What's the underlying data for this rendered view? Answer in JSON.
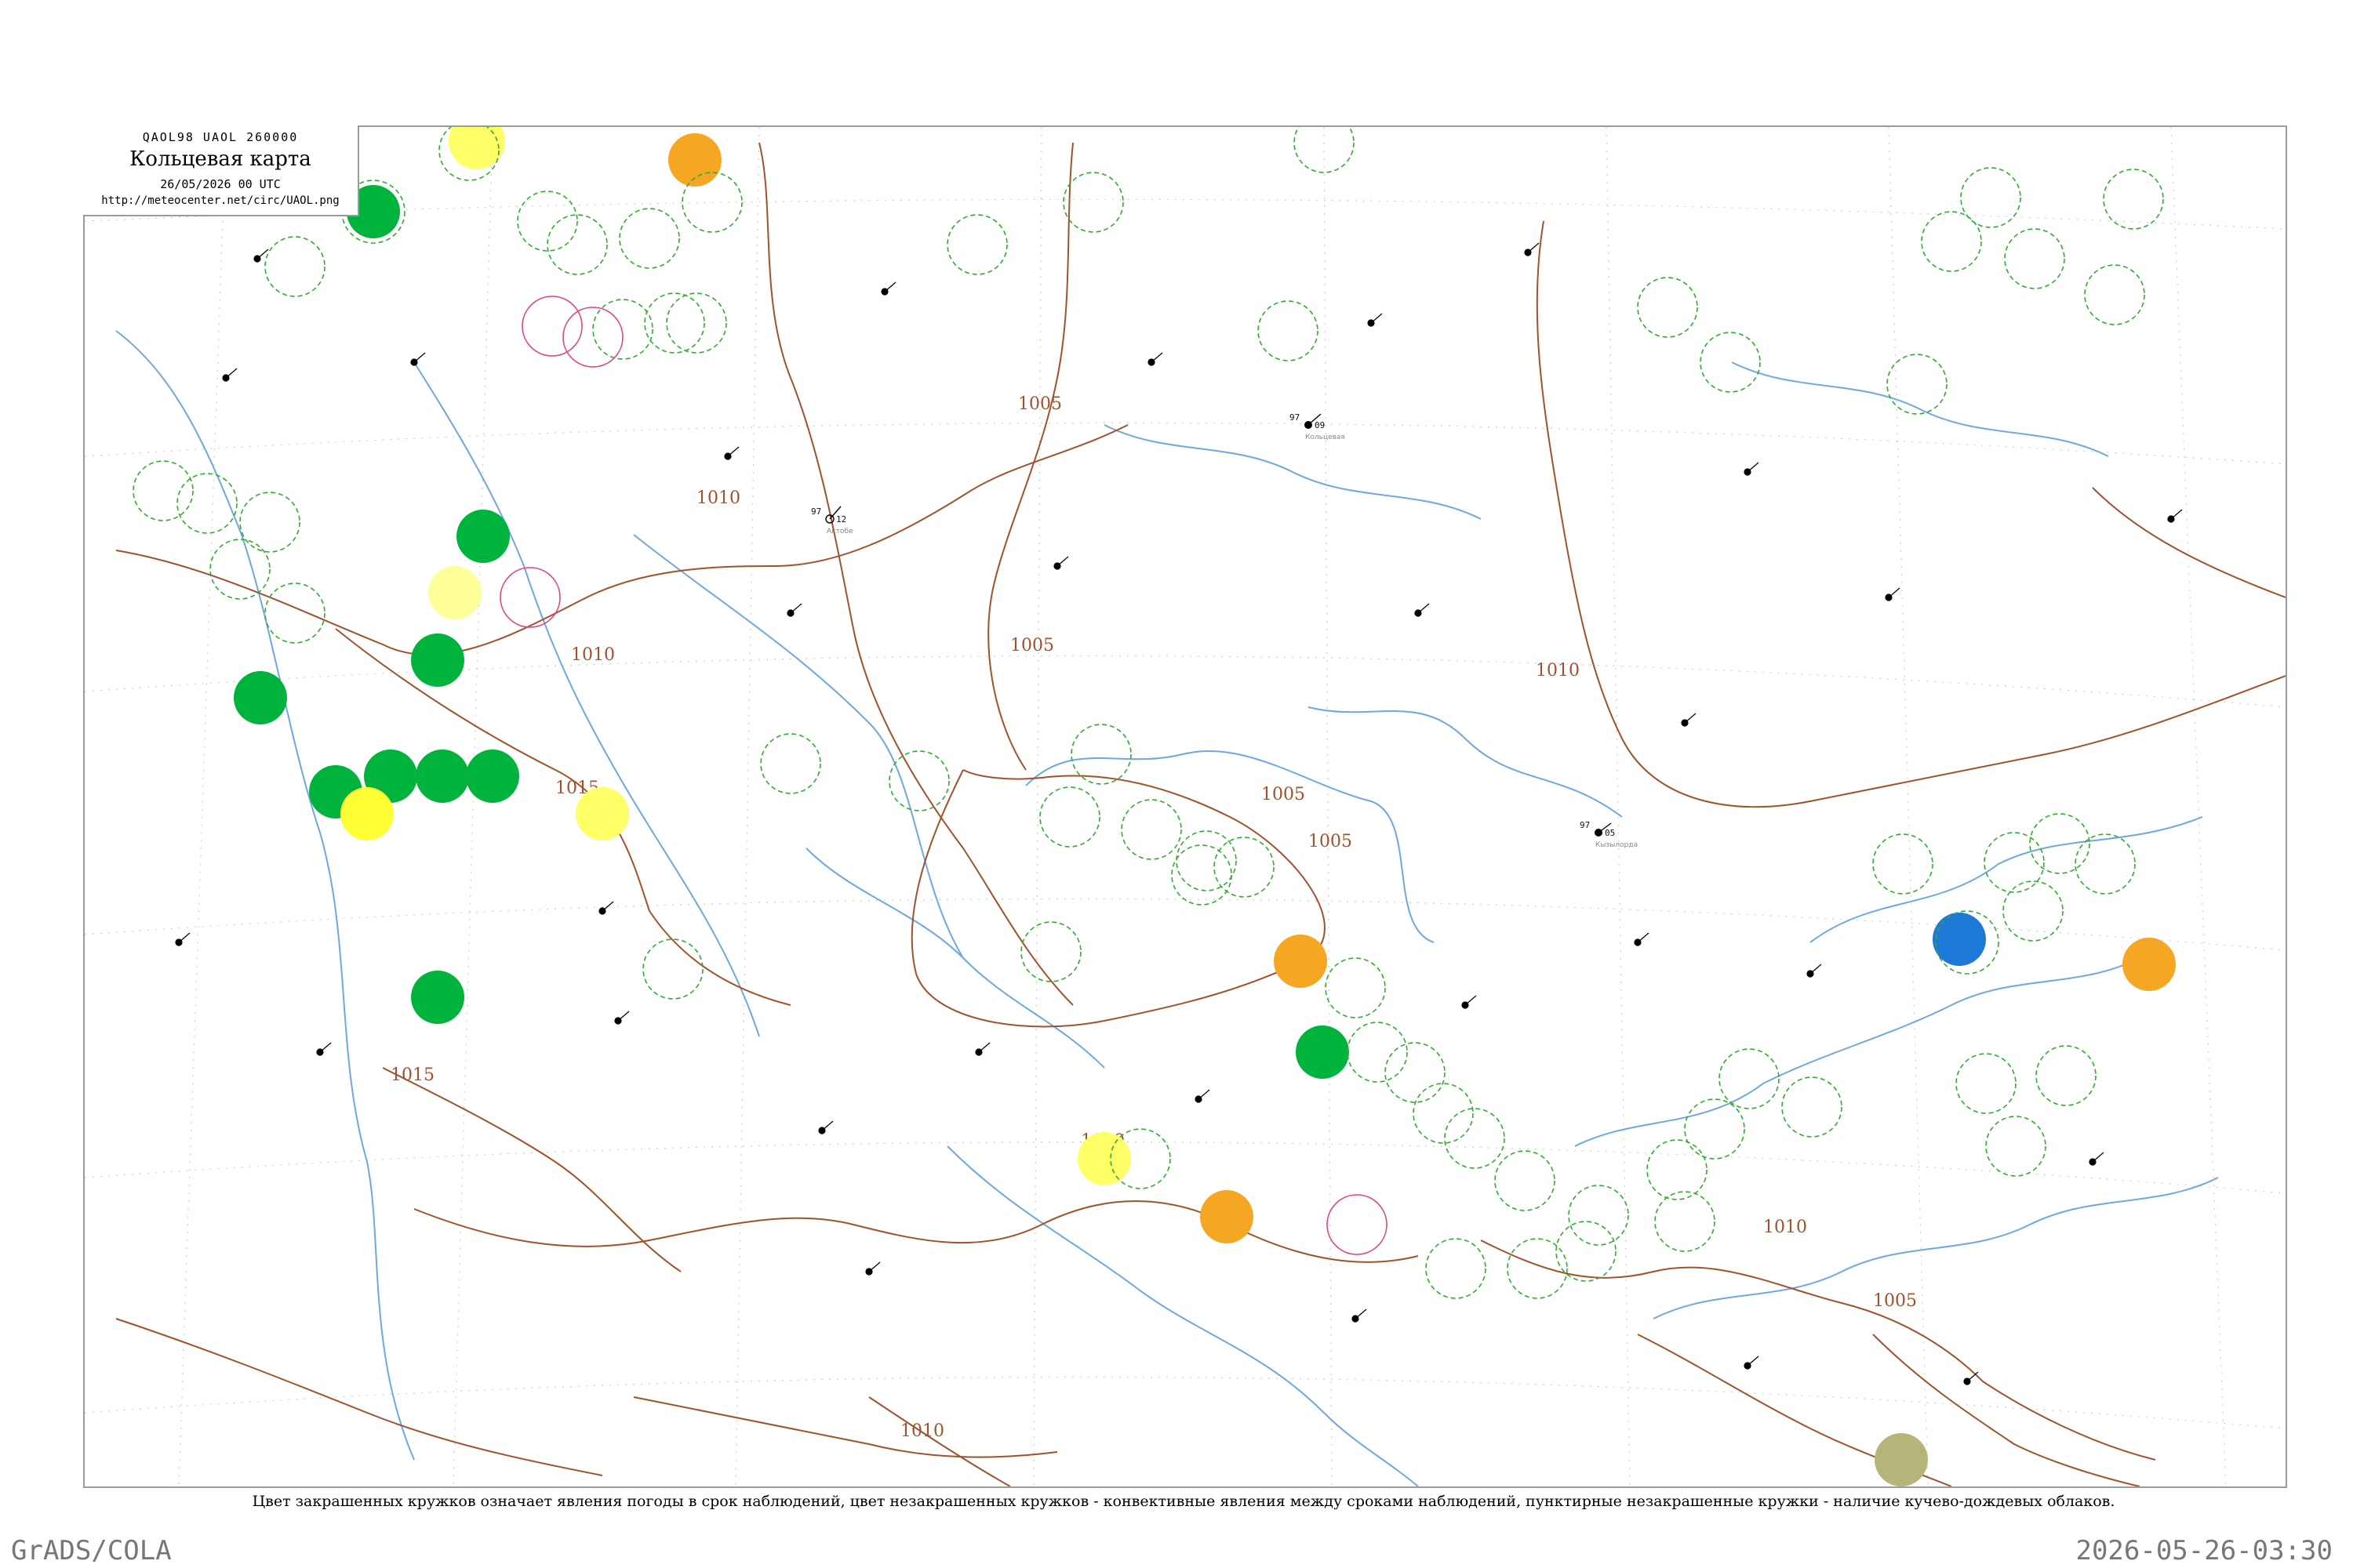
{
  "header": {
    "code": "QAOL98  UAOL  260000",
    "title": "Кольцевая карта",
    "datetime": "26/05/2026 00 UTC",
    "url": "http://meteocenter.net/circ/UAOL.png"
  },
  "caption": "Цвет закрашенных кружков означает явления погоды в срок наблюдений, цвет незакрашенных кружков - конвективные явления между сроками наблюдений, пунктирные незакрашенные кружки - наличие кучево-дождевых облаков.",
  "footer": {
    "left": "GrADS/COLA",
    "right": "2026-05-26-03:30"
  },
  "colors": {
    "frame": "#9a9a9a",
    "isobar": "#a0522d",
    "rivers": "#6fa8dc",
    "thunder_green": "#00b33c",
    "fog_yellow": "#ffff33",
    "haze_orange": "#f5a623",
    "rain_blue": "#1e78d8",
    "dust_olive": "#b5b57a",
    "cb_dashed": "#33aa33",
    "convective_pink": "#dd4488"
  },
  "isobar_labels": [
    "1005",
    "1010",
    "1015",
    "1005",
    "1005",
    "1010",
    "1010",
    "1015",
    "1010",
    "1005",
    "1010",
    "1010",
    "1005"
  ],
  "station_samples": [
    {
      "name": "Кольцевая",
      "temp": "97",
      "pressure": "09"
    },
    {
      "name": "Актобе",
      "temp": "97",
      "pressure": "12"
    },
    {
      "name": "Кызылорда",
      "temp": "97",
      "pressure": "05"
    }
  ]
}
